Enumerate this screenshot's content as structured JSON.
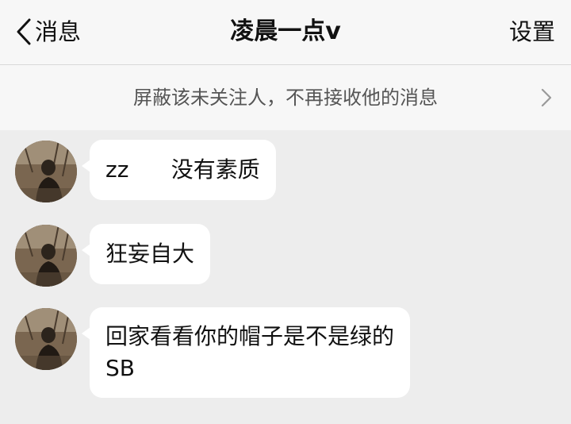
{
  "nav": {
    "back_label": "消息",
    "title": "凌晨一点v",
    "settings_label": "设置"
  },
  "banner": {
    "text": "屏蔽该未关注人，不再接收他的消息",
    "chevron_icon": "chevron-right-icon"
  },
  "messages": [
    {
      "avatar_icon": "user-avatar",
      "text": "zz      没有素质"
    },
    {
      "avatar_icon": "user-avatar",
      "text": "狂妄自大"
    },
    {
      "avatar_icon": "user-avatar",
      "lines": [
        "回家看看你的帽子是不是绿的",
        "SB"
      ]
    }
  ],
  "colors": {
    "background": "#ededed",
    "bar": "#f7f7f7",
    "bubble": "#ffffff",
    "text": "#111111",
    "muted_text": "#555555"
  }
}
